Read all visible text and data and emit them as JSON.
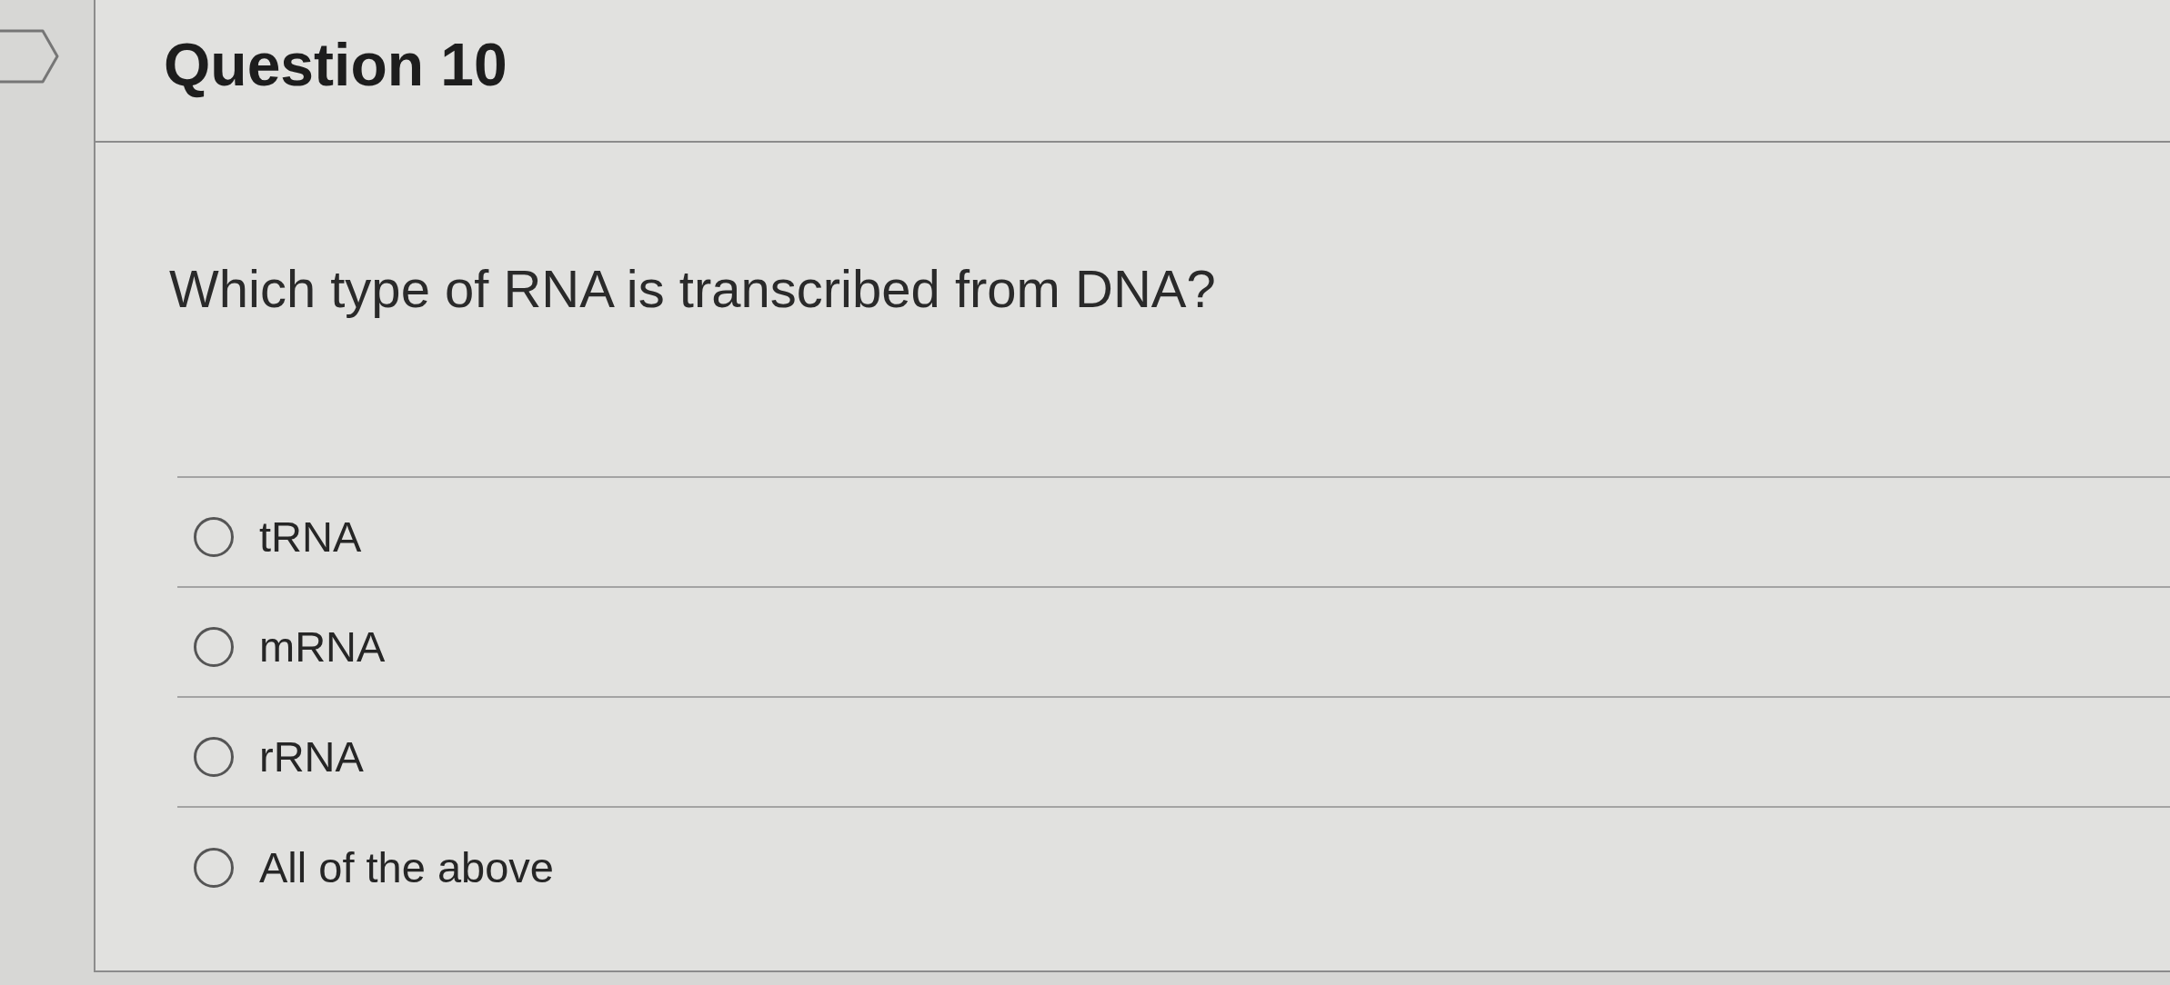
{
  "question": {
    "flagged": false,
    "title": "Question 10",
    "text": "Which type of RNA is transcribed from DNA?",
    "answers": [
      {
        "label": "tRNA",
        "selected": false
      },
      {
        "label": "mRNA",
        "selected": false
      },
      {
        "label": "rRNA",
        "selected": false
      },
      {
        "label": "All of the above",
        "selected": false
      }
    ]
  }
}
